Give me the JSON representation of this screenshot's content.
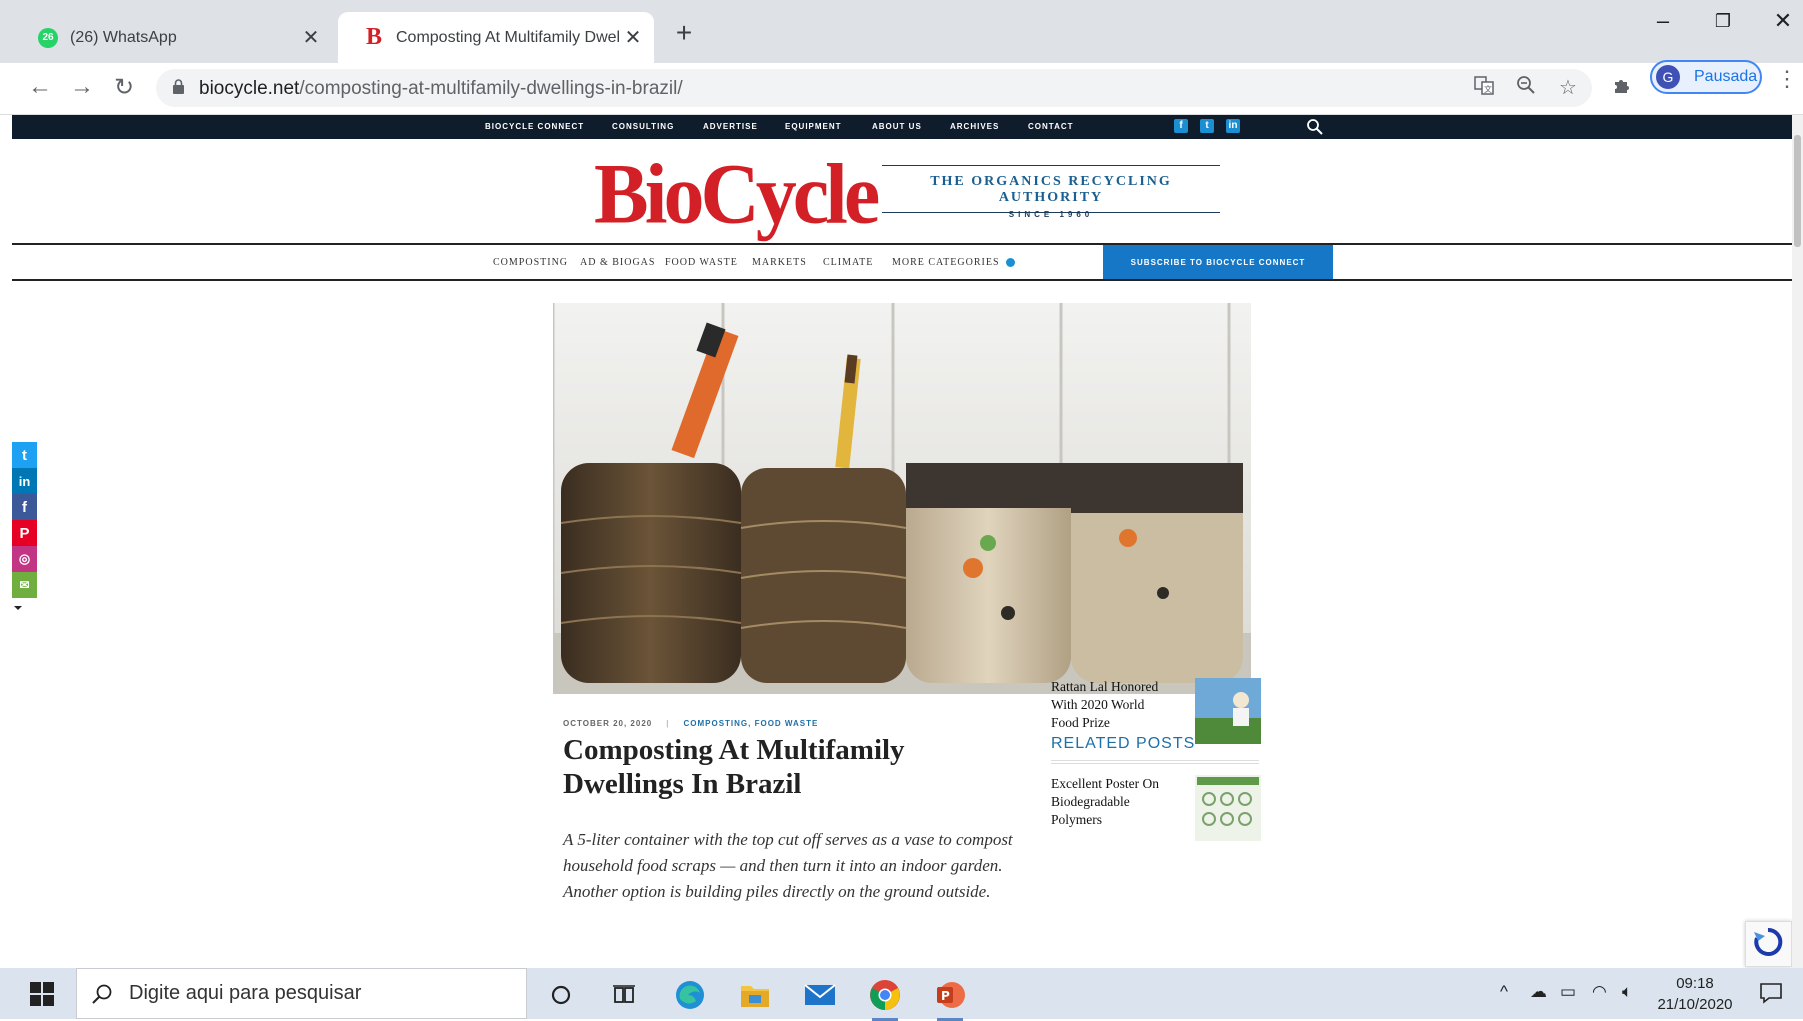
{
  "browser": {
    "tabs": [
      {
        "title": "(26) WhatsApp",
        "badge": "26",
        "active": false
      },
      {
        "title": "Composting At Multifamily Dwell",
        "active": true
      }
    ],
    "url_host": "biocycle.net",
    "url_path": "/composting-at-multifamily-dwellings-in-brazil/",
    "profile_initial": "G",
    "profile_label": "Pausada"
  },
  "site": {
    "top_nav": [
      "BIOCYCLE CONNECT",
      "CONSULTING",
      "ADVERTISE",
      "EQUIPMENT",
      "ABOUT US",
      "ARCHIVES",
      "CONTACT"
    ],
    "logo_text": "BioCycle",
    "tagline": "THE ORGANICS RECYCLING AUTHORITY",
    "since": "SINCE 1960",
    "categories": [
      "COMPOSTING",
      "AD & BIOGAS",
      "FOOD WASTE",
      "MARKETS",
      "CLIMATE",
      "MORE CATEGORIES"
    ],
    "subscribe_label": "SUBSCRIBE TO BIOCYCLE CONNECT"
  },
  "article": {
    "date": "OCTOBER 20, 2020",
    "categories": "COMPOSTING, FOOD WASTE",
    "title": "Composting At Multifamily Dwellings In Brazil",
    "excerpt": "A 5-liter container with the top cut off serves as a vase to compost household food scraps — and then turn it into an indoor garden. Another option is building piles directly on the ground outside."
  },
  "related": {
    "heading": "RELATED POSTS",
    "items": [
      {
        "title": "Rattan Lal Honored With 2020 World Food Prize"
      },
      {
        "title": "Excellent Poster On Biodegradable Polymers"
      }
    ]
  },
  "taskbar": {
    "search_placeholder": "Digite aqui para pesquisar",
    "time": "09:18",
    "date": "21/10/2020"
  },
  "colors": {
    "brand_red": "#d32027",
    "nav_dark": "#0e1c2c",
    "accent_blue": "#1677c7"
  }
}
